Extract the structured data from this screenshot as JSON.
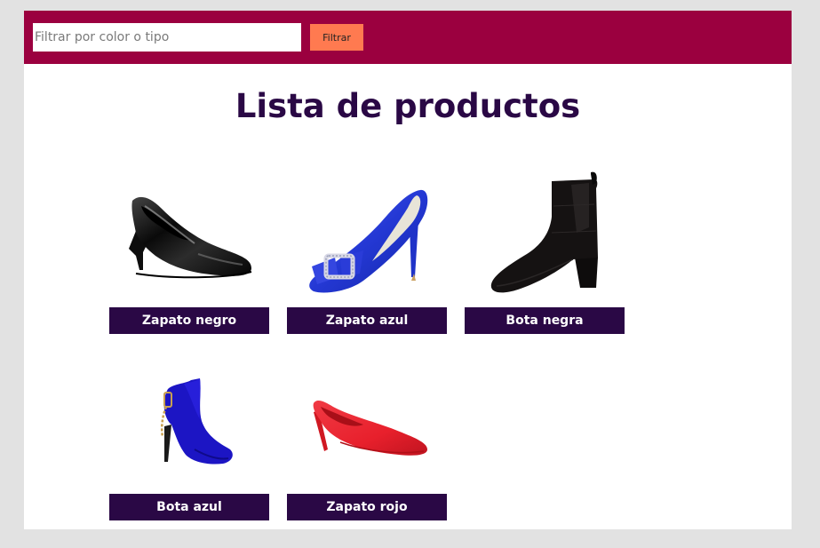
{
  "header": {
    "filter_placeholder": "Filtrar por color o tipo",
    "filter_button_label": "Filtrar"
  },
  "main": {
    "title": "Lista de productos",
    "products": [
      {
        "name": "Zapato negro",
        "image": "black-pump-icon",
        "color": "#0a0a0a"
      },
      {
        "name": "Zapato azul",
        "image": "blue-pump-icon",
        "color": "#2438d4"
      },
      {
        "name": "Bota negra",
        "image": "black-boot-icon",
        "color": "#151212"
      },
      {
        "name": "Bota azul",
        "image": "blue-boot-icon",
        "color": "#1c15c4"
      },
      {
        "name": "Zapato rojo",
        "image": "red-pump-icon",
        "color": "#e8202c"
      }
    ]
  },
  "colors": {
    "header_bg": "#9b003f",
    "button_bg": "#ff7a50",
    "title_color": "#2a0845",
    "label_bg": "#2a0845",
    "page_bg": "#e2e2e2"
  }
}
